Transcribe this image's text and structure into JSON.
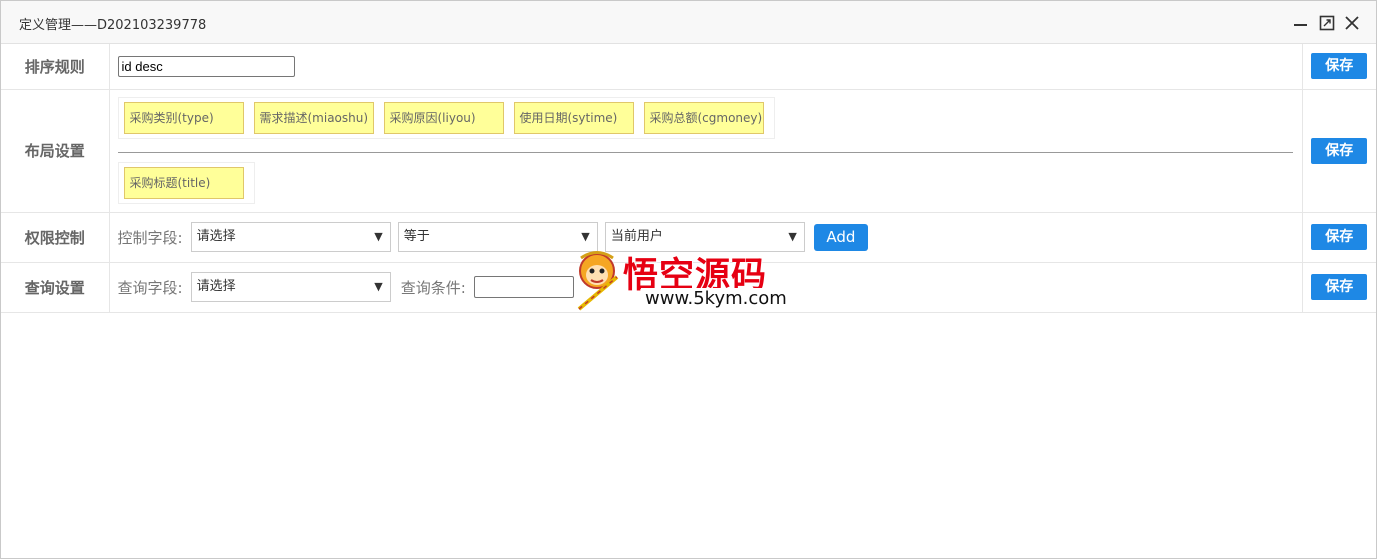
{
  "window": {
    "title": "定义管理——D202103239778",
    "controls": [
      "minimize-icon",
      "maximize-icon",
      "close-icon"
    ]
  },
  "rows": {
    "sort": {
      "label": "排序规则",
      "value": "id desc",
      "save_label": "保存"
    },
    "layout": {
      "label": "布局设置",
      "top_fields": [
        "采购类别(type)",
        "需求描述(miaoshu)",
        "采购原因(liyou)",
        "使用日期(sytime)",
        "采购总额(cgmoney)"
      ],
      "bottom_fields": [
        "采购标题(title)"
      ],
      "save_label": "保存"
    },
    "permission": {
      "label": "权限控制",
      "field_label": "控制字段:",
      "field_select": "请选择",
      "operator_select": "等于",
      "value_select": "当前用户",
      "add_label": "Add",
      "save_label": "保存"
    },
    "query": {
      "label": "查询设置",
      "field_label": "查询字段:",
      "field_select": "请选择",
      "condition_label": "查询条件:",
      "condition_value": "",
      "save_label": "保存"
    }
  },
  "watermark": {
    "name": "悟空源码",
    "url": "www.5kym.com",
    "accent": "#e60012"
  },
  "colors": {
    "accent": "#1e88e5",
    "chip_bg": "#ffff99",
    "chip_border": "#e0c76a"
  }
}
